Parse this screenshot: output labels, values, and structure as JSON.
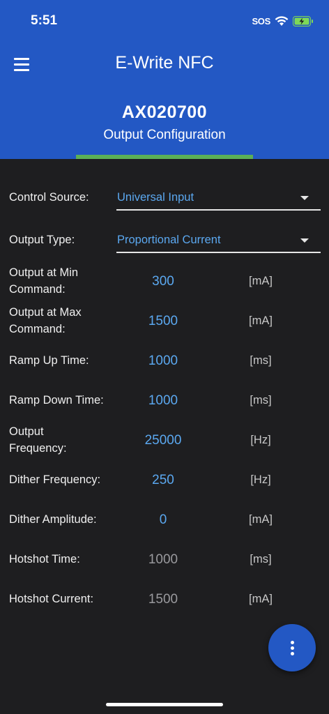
{
  "status_bar": {
    "time": "5:51",
    "sos": "SOS"
  },
  "header": {
    "app_title": "E-Write NFC",
    "device_id": "AX020700",
    "page_title": "Output Configuration"
  },
  "colors": {
    "header": "#2358c4",
    "tab_indicator": "#5bb057",
    "value": "#5ba8f0",
    "readonly_value": "#9a9a9e",
    "background": "#1e1e20"
  },
  "form": {
    "control_source": {
      "label": "Control Source:",
      "value": "Universal Input"
    },
    "output_type": {
      "label": "Output Type:",
      "value": "Proportional Current"
    },
    "rows": [
      {
        "label_line1": "Output at Min",
        "label_line2": "Command:",
        "value": "300",
        "unit": "[mA]"
      },
      {
        "label_line1": "Output at Max",
        "label_line2": "Command:",
        "value": "1500",
        "unit": "[mA]"
      },
      {
        "label": "Ramp Up Time:",
        "value": "1000",
        "unit": "[ms]"
      },
      {
        "label": "Ramp Down Time:",
        "value": "1000",
        "unit": "[ms]"
      },
      {
        "label_line1": "Output",
        "label_line2": "Frequency:",
        "value": "25000",
        "unit": "[Hz]"
      },
      {
        "label": "Dither Frequency:",
        "value": "250",
        "unit": "[Hz]"
      },
      {
        "label": "Dither Amplitude:",
        "value": "0",
        "unit": "[mA]"
      },
      {
        "label": "Hotshot Time:",
        "value": "1000",
        "unit": "[ms]"
      },
      {
        "label": "Hotshot Current:",
        "value": "1500",
        "unit": "[mA]"
      }
    ]
  },
  "fab": {
    "icon": "more-vertical-icon"
  }
}
